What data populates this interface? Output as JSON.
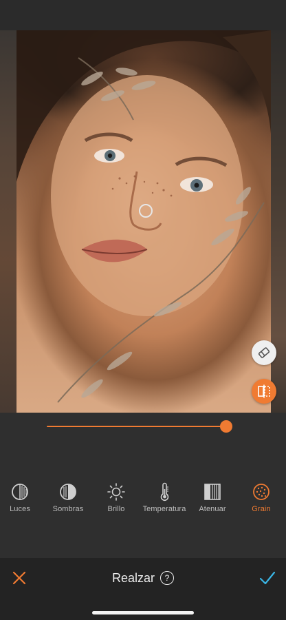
{
  "editor": {
    "image_subject": "portrait photo",
    "intensity": 0.96
  },
  "side_tools": {
    "eraser_icon": "eraser-icon",
    "compare_icon": "compare-split-icon"
  },
  "tools": [
    {
      "label": "Luces",
      "icon": "luces-icon",
      "active": false
    },
    {
      "label": "Sombras",
      "icon": "sombras-icon",
      "active": false
    },
    {
      "label": "Brillo",
      "icon": "sun-icon",
      "active": false
    },
    {
      "label": "Temperatura",
      "icon": "thermometer-icon",
      "active": false
    },
    {
      "label": "Atenuar",
      "icon": "atenuar-icon",
      "active": false
    },
    {
      "label": "Grain",
      "icon": "grain-icon",
      "active": true
    }
  ],
  "bottom_bar": {
    "title": "Realzar",
    "help": "?",
    "cancel_icon": "close-icon",
    "confirm_icon": "checkmark-icon"
  },
  "colors": {
    "accent": "#f07b32",
    "confirm": "#3ab6e6",
    "background": "#2f2f2f"
  }
}
